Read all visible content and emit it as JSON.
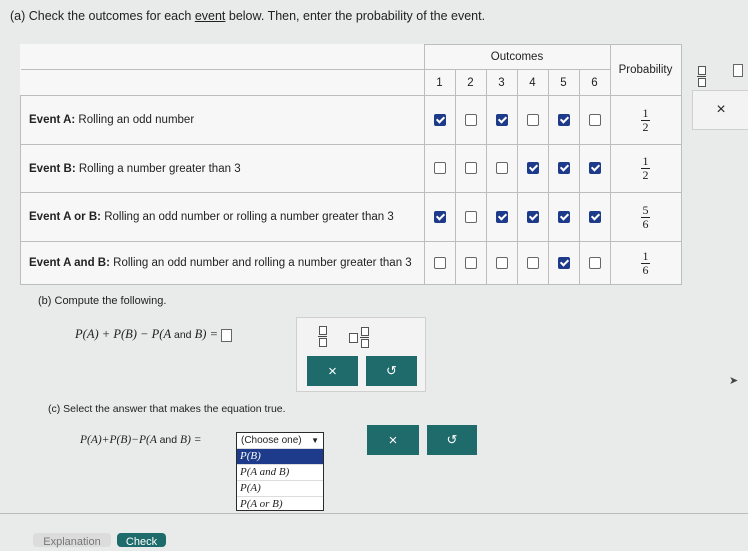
{
  "part_a": {
    "prefix": "(a) Check the outcomes for each ",
    "link": "event",
    "suffix": " below. Then, enter the probability of the event."
  },
  "table": {
    "outcomes_header": "Outcomes",
    "probability_header": "Probability",
    "outcome_numbers": [
      "1",
      "2",
      "3",
      "4",
      "5",
      "6"
    ],
    "rows": [
      {
        "event_bold": "Event A:",
        "desc": " Rolling an odd number",
        "checks": [
          true,
          false,
          true,
          false,
          true,
          false
        ],
        "num": "1",
        "den": "2"
      },
      {
        "event_bold": "Event B:",
        "desc": " Rolling a number greater than 3",
        "checks": [
          false,
          false,
          false,
          true,
          true,
          true
        ],
        "num": "1",
        "den": "2"
      },
      {
        "event_bold": "Event A or B:",
        "desc": " Rolling an odd number or rolling a number greater than 3",
        "checks": [
          true,
          false,
          true,
          true,
          true,
          true
        ],
        "num": "5",
        "den": "6"
      },
      {
        "event_bold": "Event A and B:",
        "desc": " Rolling an odd number and rolling a number greater than 3",
        "checks": [
          false,
          false,
          false,
          false,
          true,
          false
        ],
        "num": "1",
        "den": "6"
      }
    ]
  },
  "tools_a": {
    "x": "×"
  },
  "part_b": {
    "label": "(b) Compute the following.",
    "expression": "P(A) + P(B) − P(A and B) =",
    "x": "×",
    "undo": "↺"
  },
  "part_c": {
    "label": "(c) Select the answer that makes the equation true.",
    "expression": "P(A)+P(B)−P(A and B) =",
    "dropdown_value": "(Choose one)",
    "dropdown_arrow": "▼",
    "options": [
      "P(B)",
      "P(A and B)",
      "P(A)",
      "P(A or B)"
    ],
    "x": "×",
    "undo": "↺"
  },
  "footer": {
    "explanation": "Explanation",
    "check": "Check"
  },
  "colors": {
    "accent": "#1f6b6b",
    "check": "#1d3b8a"
  }
}
